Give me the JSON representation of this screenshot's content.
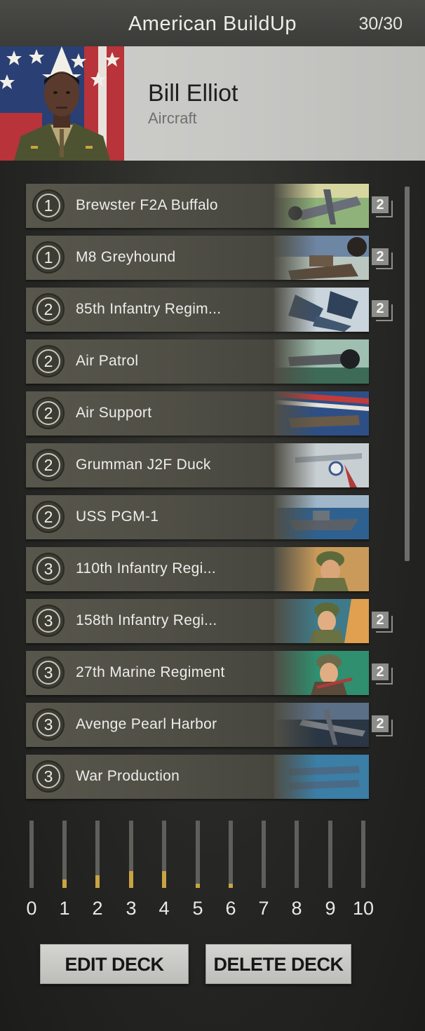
{
  "header": {
    "title": "American BuildUp",
    "deck_count": "30/30"
  },
  "commander": {
    "name": "Bill Elliot",
    "class": "Aircraft"
  },
  "cards": [
    {
      "cost": "1",
      "name": "Brewster F2A Buffalo",
      "copies": "2",
      "art": "plane-art"
    },
    {
      "cost": "1",
      "name": "M8 Greyhound",
      "copies": "2",
      "art": "vehicle-art"
    },
    {
      "cost": "2",
      "name": "85th Infantry Regim...",
      "copies": "2",
      "art": "infantry-art"
    },
    {
      "cost": "2",
      "name": "Air Patrol",
      "copies": "",
      "art": "plane-art"
    },
    {
      "cost": "2",
      "name": "Air Support",
      "copies": "",
      "art": "plane-art"
    },
    {
      "cost": "2",
      "name": "Grumman J2F Duck",
      "copies": "",
      "art": "plane-art"
    },
    {
      "cost": "2",
      "name": "USS PGM-1",
      "copies": "",
      "art": "ship-art"
    },
    {
      "cost": "3",
      "name": "110th Infantry Regi...",
      "copies": "",
      "art": "infantry-art"
    },
    {
      "cost": "3",
      "name": "158th Infantry Regi...",
      "copies": "2",
      "art": "infantry-art"
    },
    {
      "cost": "3",
      "name": "27th Marine Regiment",
      "copies": "2",
      "art": "infantry-art"
    },
    {
      "cost": "3",
      "name": "Avenge Pearl Harbor",
      "copies": "2",
      "art": "plane-art"
    },
    {
      "cost": "3",
      "name": "War Production",
      "copies": "",
      "art": "plane-art"
    }
  ],
  "mana_curve": {
    "labels": [
      "0",
      "1",
      "2",
      "3",
      "4",
      "5",
      "6",
      "7",
      "8",
      "9",
      "10"
    ],
    "fill_fraction": [
      0,
      0.12,
      0.19,
      0.25,
      0.25,
      0.06,
      0.06,
      0,
      0,
      0,
      0
    ],
    "fill_color": "#c9a443"
  },
  "buttons": {
    "edit": "EDIT DECK",
    "delete": "DELETE DECK"
  }
}
